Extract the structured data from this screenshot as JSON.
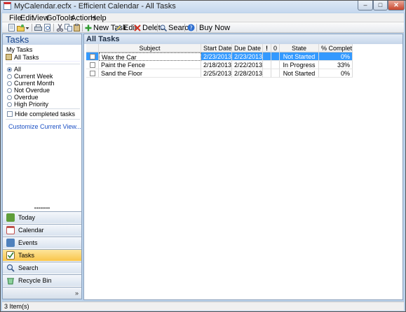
{
  "window": {
    "title": "MyCalendar.ecfx - Efficient Calendar - All Tasks",
    "controls": {
      "minimize": "‒",
      "maximize": "□",
      "close": "✕"
    }
  },
  "menu": [
    "File",
    "Edit",
    "View",
    "Go",
    "Tools",
    "Actions",
    "Help"
  ],
  "toolbar": {
    "new_task": "New Task",
    "edit": "Edit",
    "delete": "Delete",
    "search": "Search",
    "buy_now": "Buy Now"
  },
  "sidebar": {
    "title": "Tasks",
    "subtitle": "My Tasks",
    "all_tasks": "All Tasks",
    "filters": [
      {
        "label": "All",
        "checked": true
      },
      {
        "label": "Current Week",
        "checked": false
      },
      {
        "label": "Current Month",
        "checked": false
      },
      {
        "label": "Not Overdue",
        "checked": false
      },
      {
        "label": "Overdue",
        "checked": false
      },
      {
        "label": "High Priority",
        "checked": false
      }
    ],
    "hide_completed": "Hide completed tasks",
    "customize": "Customize Current View...",
    "splitter": "••••••••",
    "nav": [
      {
        "label": "Today",
        "icon": "today-icon",
        "color": "#5f9e3a"
      },
      {
        "label": "Calendar",
        "icon": "calendar-icon",
        "color": "#c0504d"
      },
      {
        "label": "Events",
        "icon": "events-icon",
        "color": "#4f81bd"
      },
      {
        "label": "Tasks",
        "icon": "tasks-icon",
        "color": "#e8b33a"
      },
      {
        "label": "Search",
        "icon": "search-icon",
        "color": "#6a8cc7"
      },
      {
        "label": "Recycle Bin",
        "icon": "recycle-bin-icon",
        "color": "#3a9e4f"
      }
    ],
    "active_nav": "Tasks",
    "chevron": "»"
  },
  "main": {
    "title": "All Tasks",
    "columns": {
      "subject": "Subject",
      "start": "Start Date",
      "due": "Due Date",
      "priority": "!",
      "attachment": "0",
      "state": "State",
      "complete": "% Complete"
    },
    "rows": [
      {
        "subject": "Wax the Car",
        "start": "2/23/2013",
        "due": "2/23/2013",
        "state": "Not Started",
        "complete": "0%",
        "selected": true
      },
      {
        "subject": "Paint the Fence",
        "start": "2/18/2013",
        "due": "2/22/2013",
        "state": "In Progress",
        "complete": "33%",
        "selected": false
      },
      {
        "subject": "Sand the Floor",
        "start": "2/25/2013",
        "due": "2/28/2013",
        "state": "Not Started",
        "complete": "0%",
        "selected": false
      }
    ]
  },
  "status": "3 Item(s)"
}
